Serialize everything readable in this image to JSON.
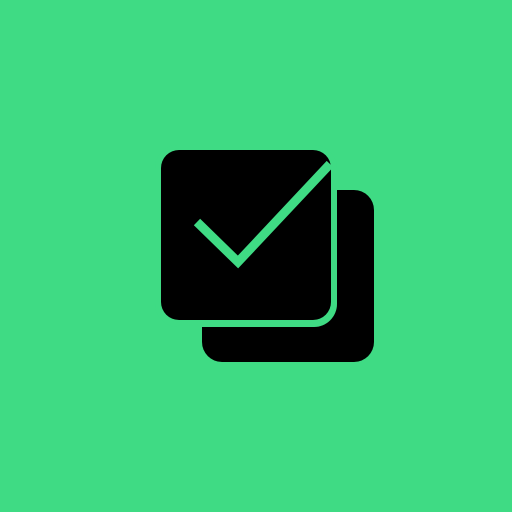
{
  "icon": {
    "name": "stacked-checkbox-icon",
    "background_color": "#3fdb84",
    "foreground_color": "#000000",
    "check_color": "#3fdb84"
  }
}
